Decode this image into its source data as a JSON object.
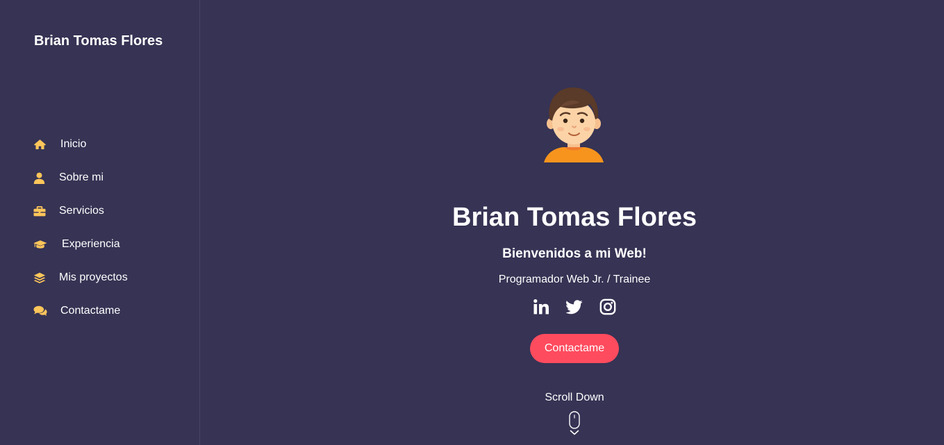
{
  "sidebar": {
    "brand": "Brian Tomas Flores",
    "items": [
      {
        "label": "Inicio",
        "icon": "home-icon"
      },
      {
        "label": "Sobre mi",
        "icon": "user-icon"
      },
      {
        "label": "Servicios",
        "icon": "briefcase-icon"
      },
      {
        "label": "Experiencia",
        "icon": "graduation-cap-icon"
      },
      {
        "label": "Mis proyectos",
        "icon": "layers-icon"
      },
      {
        "label": "Contactame",
        "icon": "comments-icon"
      }
    ]
  },
  "hero": {
    "name": "Brian Tomas Flores",
    "welcome": "Bienvenidos a mi Web!",
    "role": "Programador Web Jr. / Trainee",
    "socials": [
      "linkedin-icon",
      "twitter-icon",
      "instagram-icon"
    ],
    "cta_label": "Contactame",
    "scroll_label": "Scroll Down"
  },
  "colors": {
    "background": "#363354",
    "accent": "#ff4b5e",
    "icon": "#ffc65a"
  }
}
